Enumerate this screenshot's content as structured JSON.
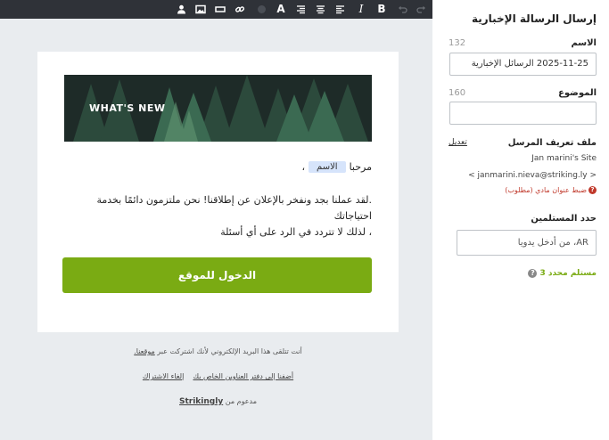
{
  "toolbar": {
    "items": [
      {
        "name": "user-icon"
      },
      {
        "name": "image-icon"
      },
      {
        "name": "divider-icon"
      },
      {
        "name": "link-icon"
      },
      {
        "name": "color-circle-icon",
        "color": "#4a4e55"
      },
      {
        "name": "font-size-icon",
        "label": "A"
      },
      {
        "name": "align-right-icon"
      },
      {
        "name": "align-center-icon"
      },
      {
        "name": "align-left-icon"
      },
      {
        "name": "italic-icon",
        "label": "I"
      },
      {
        "name": "bold-icon",
        "label": "B"
      },
      {
        "name": "undo-icon"
      },
      {
        "name": "redo-icon"
      }
    ]
  },
  "email": {
    "banner_text": "WHAT'S NEW",
    "greeting": "مرحبا",
    "name_placeholder": "الاسم",
    "greeting_comma": "،",
    "body_line1": ".لقد عملنا بجد ونفخر بالإعلان عن إطلاقنا! نحن ملتزمون دائمًا بخدمة احتياجاتك",
    "body_line2": "، لذلك لا تتردد في الرد على أي أسئلة",
    "cta_label": "الدخول للموقع",
    "colors": {
      "cta": "#7aab13",
      "banner_bg": "#1f2e2a"
    }
  },
  "footer": {
    "line1_text": "أنت تتلقى هذا البريد الإلكتروني لأنك اشتركت عبر",
    "line1_link": "موقعنا.",
    "add_contacts_link": "أضفنا إلى دفتر العناوين الخاص بك",
    "unsubscribe_link": "إلغاء الاشتراك",
    "powered_by": "مدعوم من",
    "brand": "Strikingly"
  },
  "panel": {
    "title": "إرسال الرسالة الإخبارية",
    "name_label": "الاسم",
    "name_count": "132",
    "name_value": "2025-11-25 الرسائل الإخبارية",
    "subject_label": "الموضوع",
    "subject_count": "160",
    "subject_value": "",
    "sender_label": "ملف تعريف المرسل",
    "edit_link": "تعديل",
    "sender_name": "Jan marini's Site",
    "sender_email": "< janmarini.nieva@striking.ly >",
    "error_text": "ضبط عنوان مادي (مطلوب)",
    "recipients_label": "حدد المستلمين",
    "recipients_placeholder": "AR، من أدخل يدويا",
    "recipients_count": "مستلم محدد 3",
    "help_symbol": "?",
    "error_symbol": "?"
  }
}
